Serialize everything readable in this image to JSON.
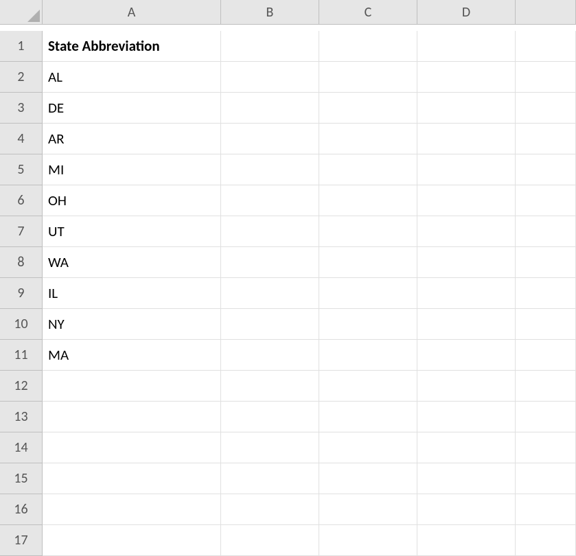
{
  "columns": [
    "A",
    "B",
    "C",
    "D",
    ""
  ],
  "rows": [
    1,
    2,
    3,
    4,
    5,
    6,
    7,
    8,
    9,
    10,
    11,
    12,
    13,
    14,
    15,
    16,
    17
  ],
  "header_row_index": 0,
  "cells": {
    "A1": {
      "value": "State Abbreviation",
      "bold": true
    },
    "A2": {
      "value": "AL"
    },
    "A3": {
      "value": "DE"
    },
    "A4": {
      "value": "AR"
    },
    "A5": {
      "value": "MI"
    },
    "A6": {
      "value": "OH"
    },
    "A7": {
      "value": "UT"
    },
    "A8": {
      "value": "WA"
    },
    "A9": {
      "value": "IL"
    },
    "A10": {
      "value": "NY"
    },
    "A11": {
      "value": "MA"
    }
  }
}
